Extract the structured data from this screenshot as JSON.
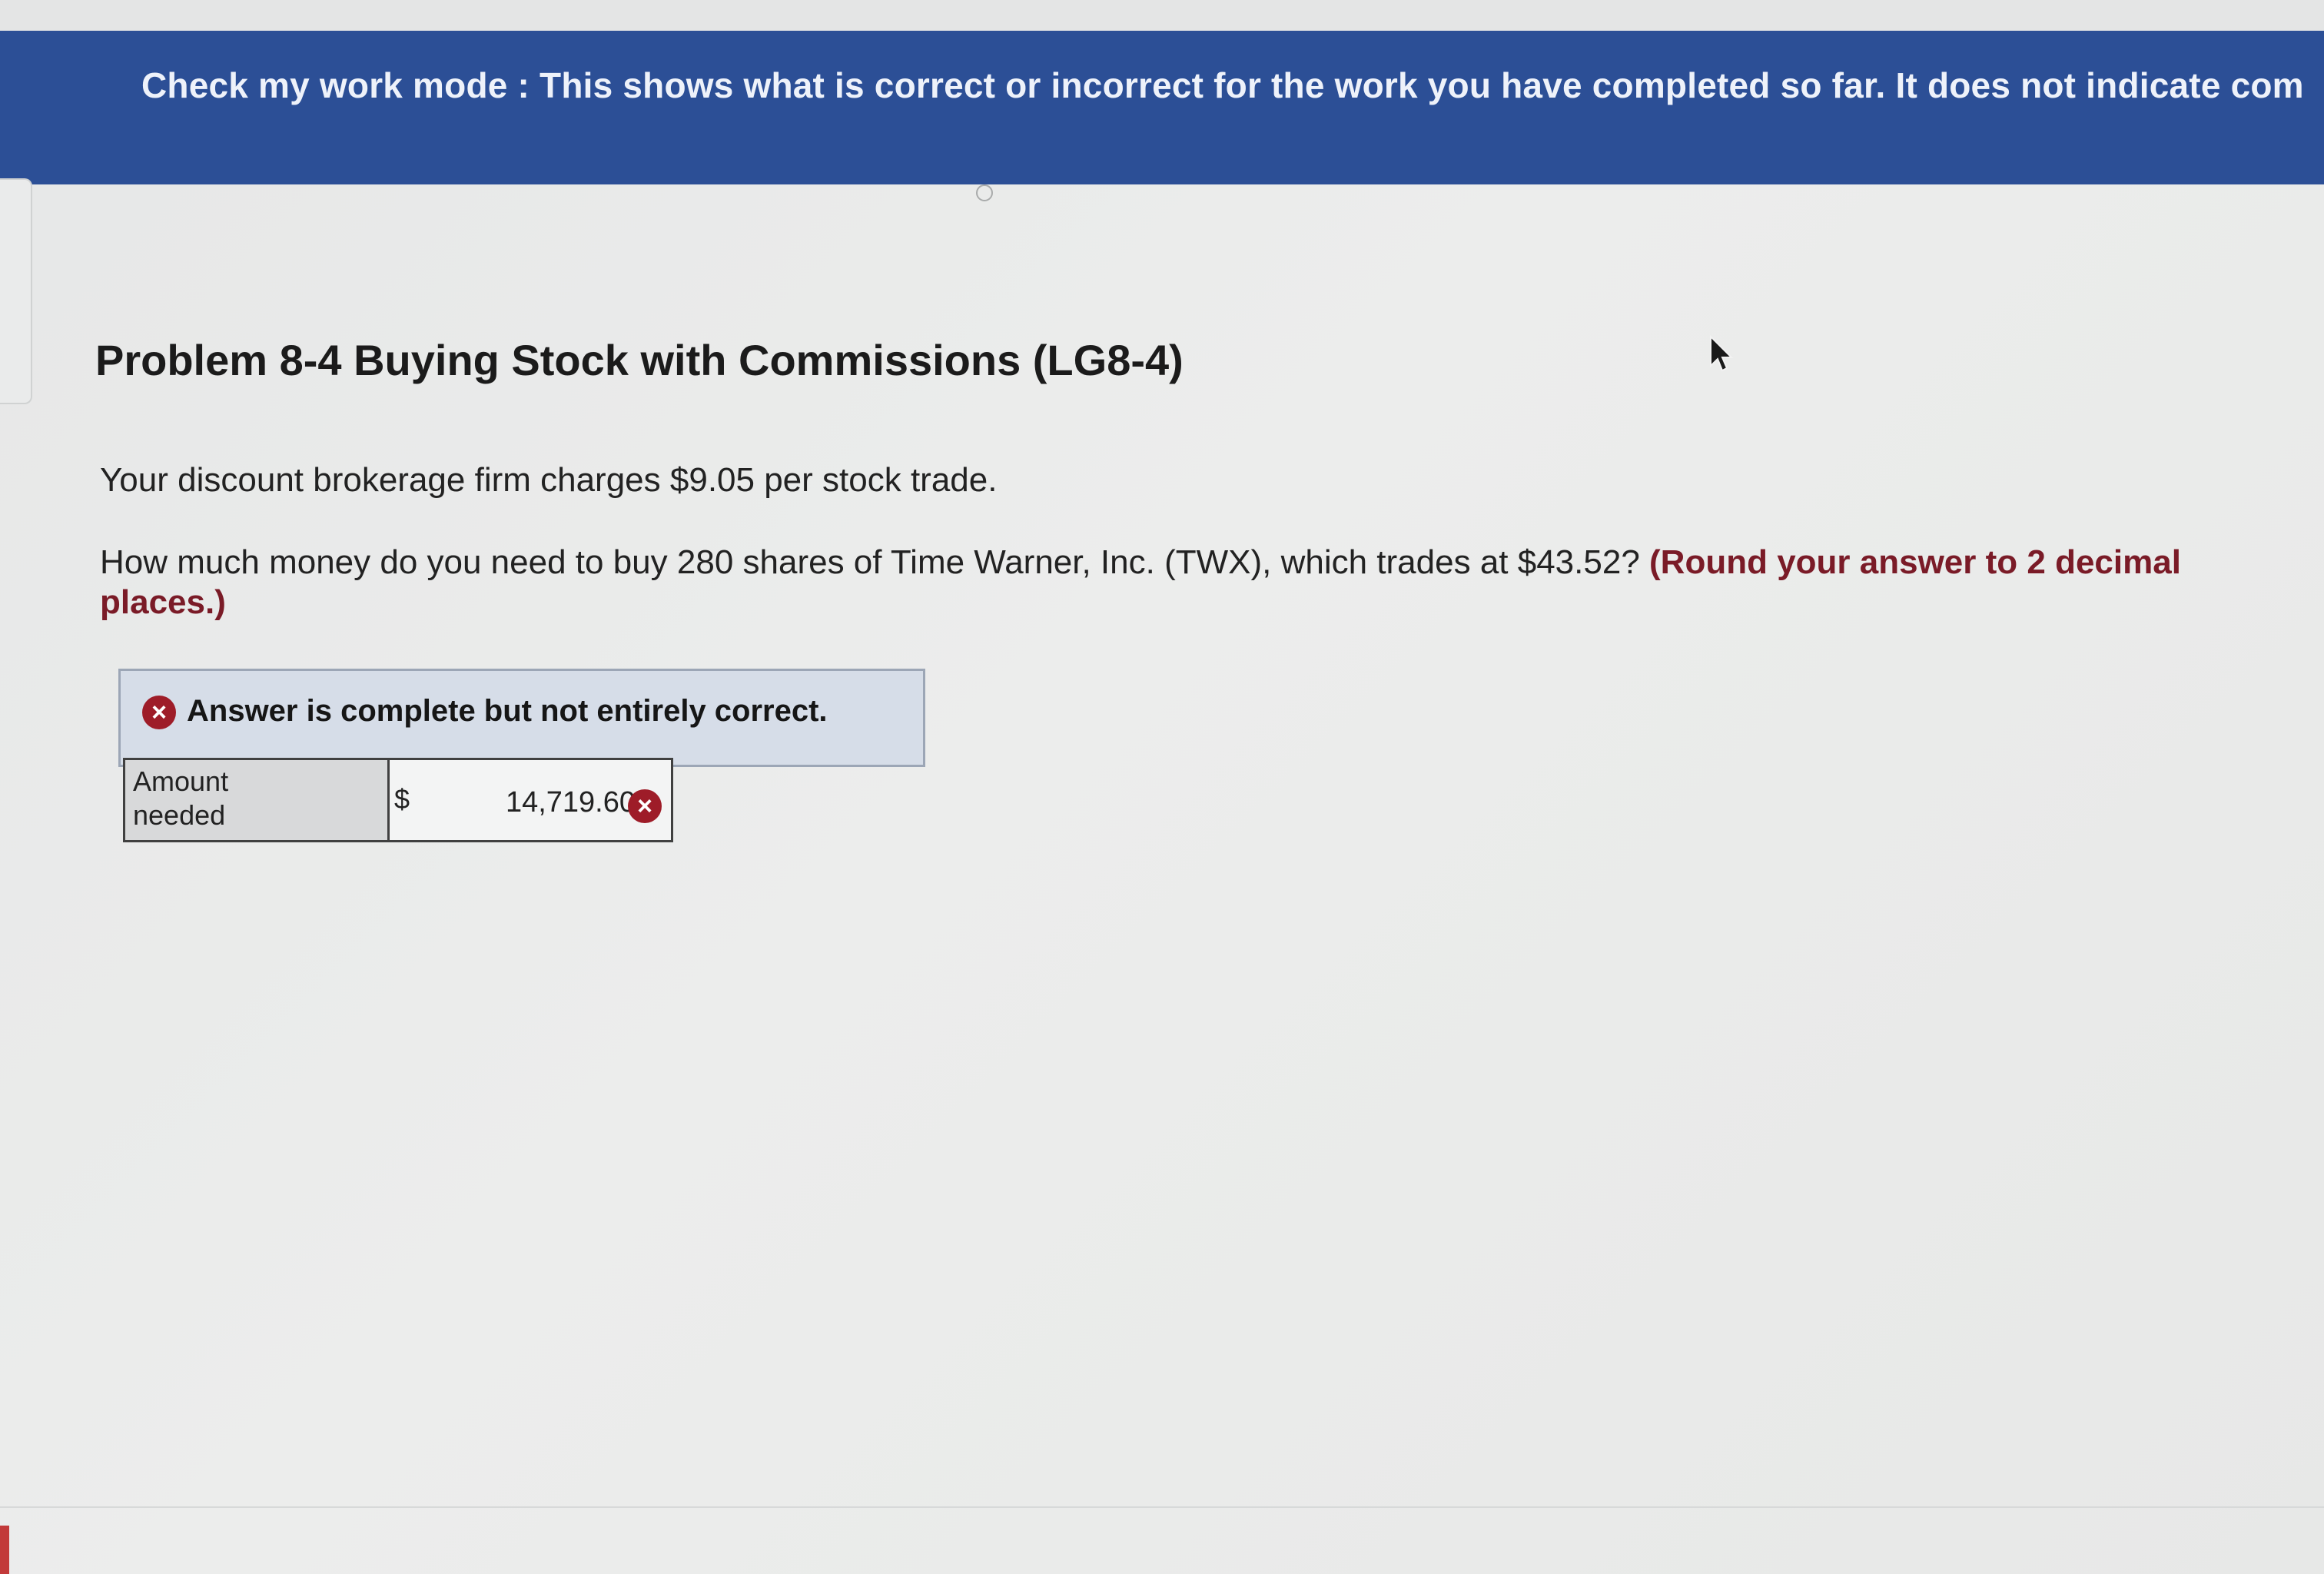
{
  "banner": {
    "text": "Check my work mode : This shows what is correct or incorrect for the work you have completed so far. It does not indicate com"
  },
  "problem": {
    "title": "Problem 8-4 Buying Stock with Commissions (LG8-4)",
    "intro": "Your discount brokerage firm charges $9.05 per stock trade.",
    "question": "How much money do you need to buy 280 shares of Time Warner, Inc. (TWX), which trades at $43.52?",
    "hint": "(Round your answer to 2 decimal places.)"
  },
  "result": {
    "status_text": "Answer is complete but not entirely correct.",
    "status_icon": "x-circle-icon"
  },
  "answer_table": {
    "label_line1": "Amount",
    "label_line2": "needed",
    "currency": "$",
    "value": "14,719.60",
    "value_status_icon": "x-circle-icon"
  },
  "colors": {
    "banner_bg": "#2c4f96",
    "hint_color": "#7a1b27",
    "incorrect_red": "#9e1c28",
    "result_box_bg": "#d6dde8"
  }
}
